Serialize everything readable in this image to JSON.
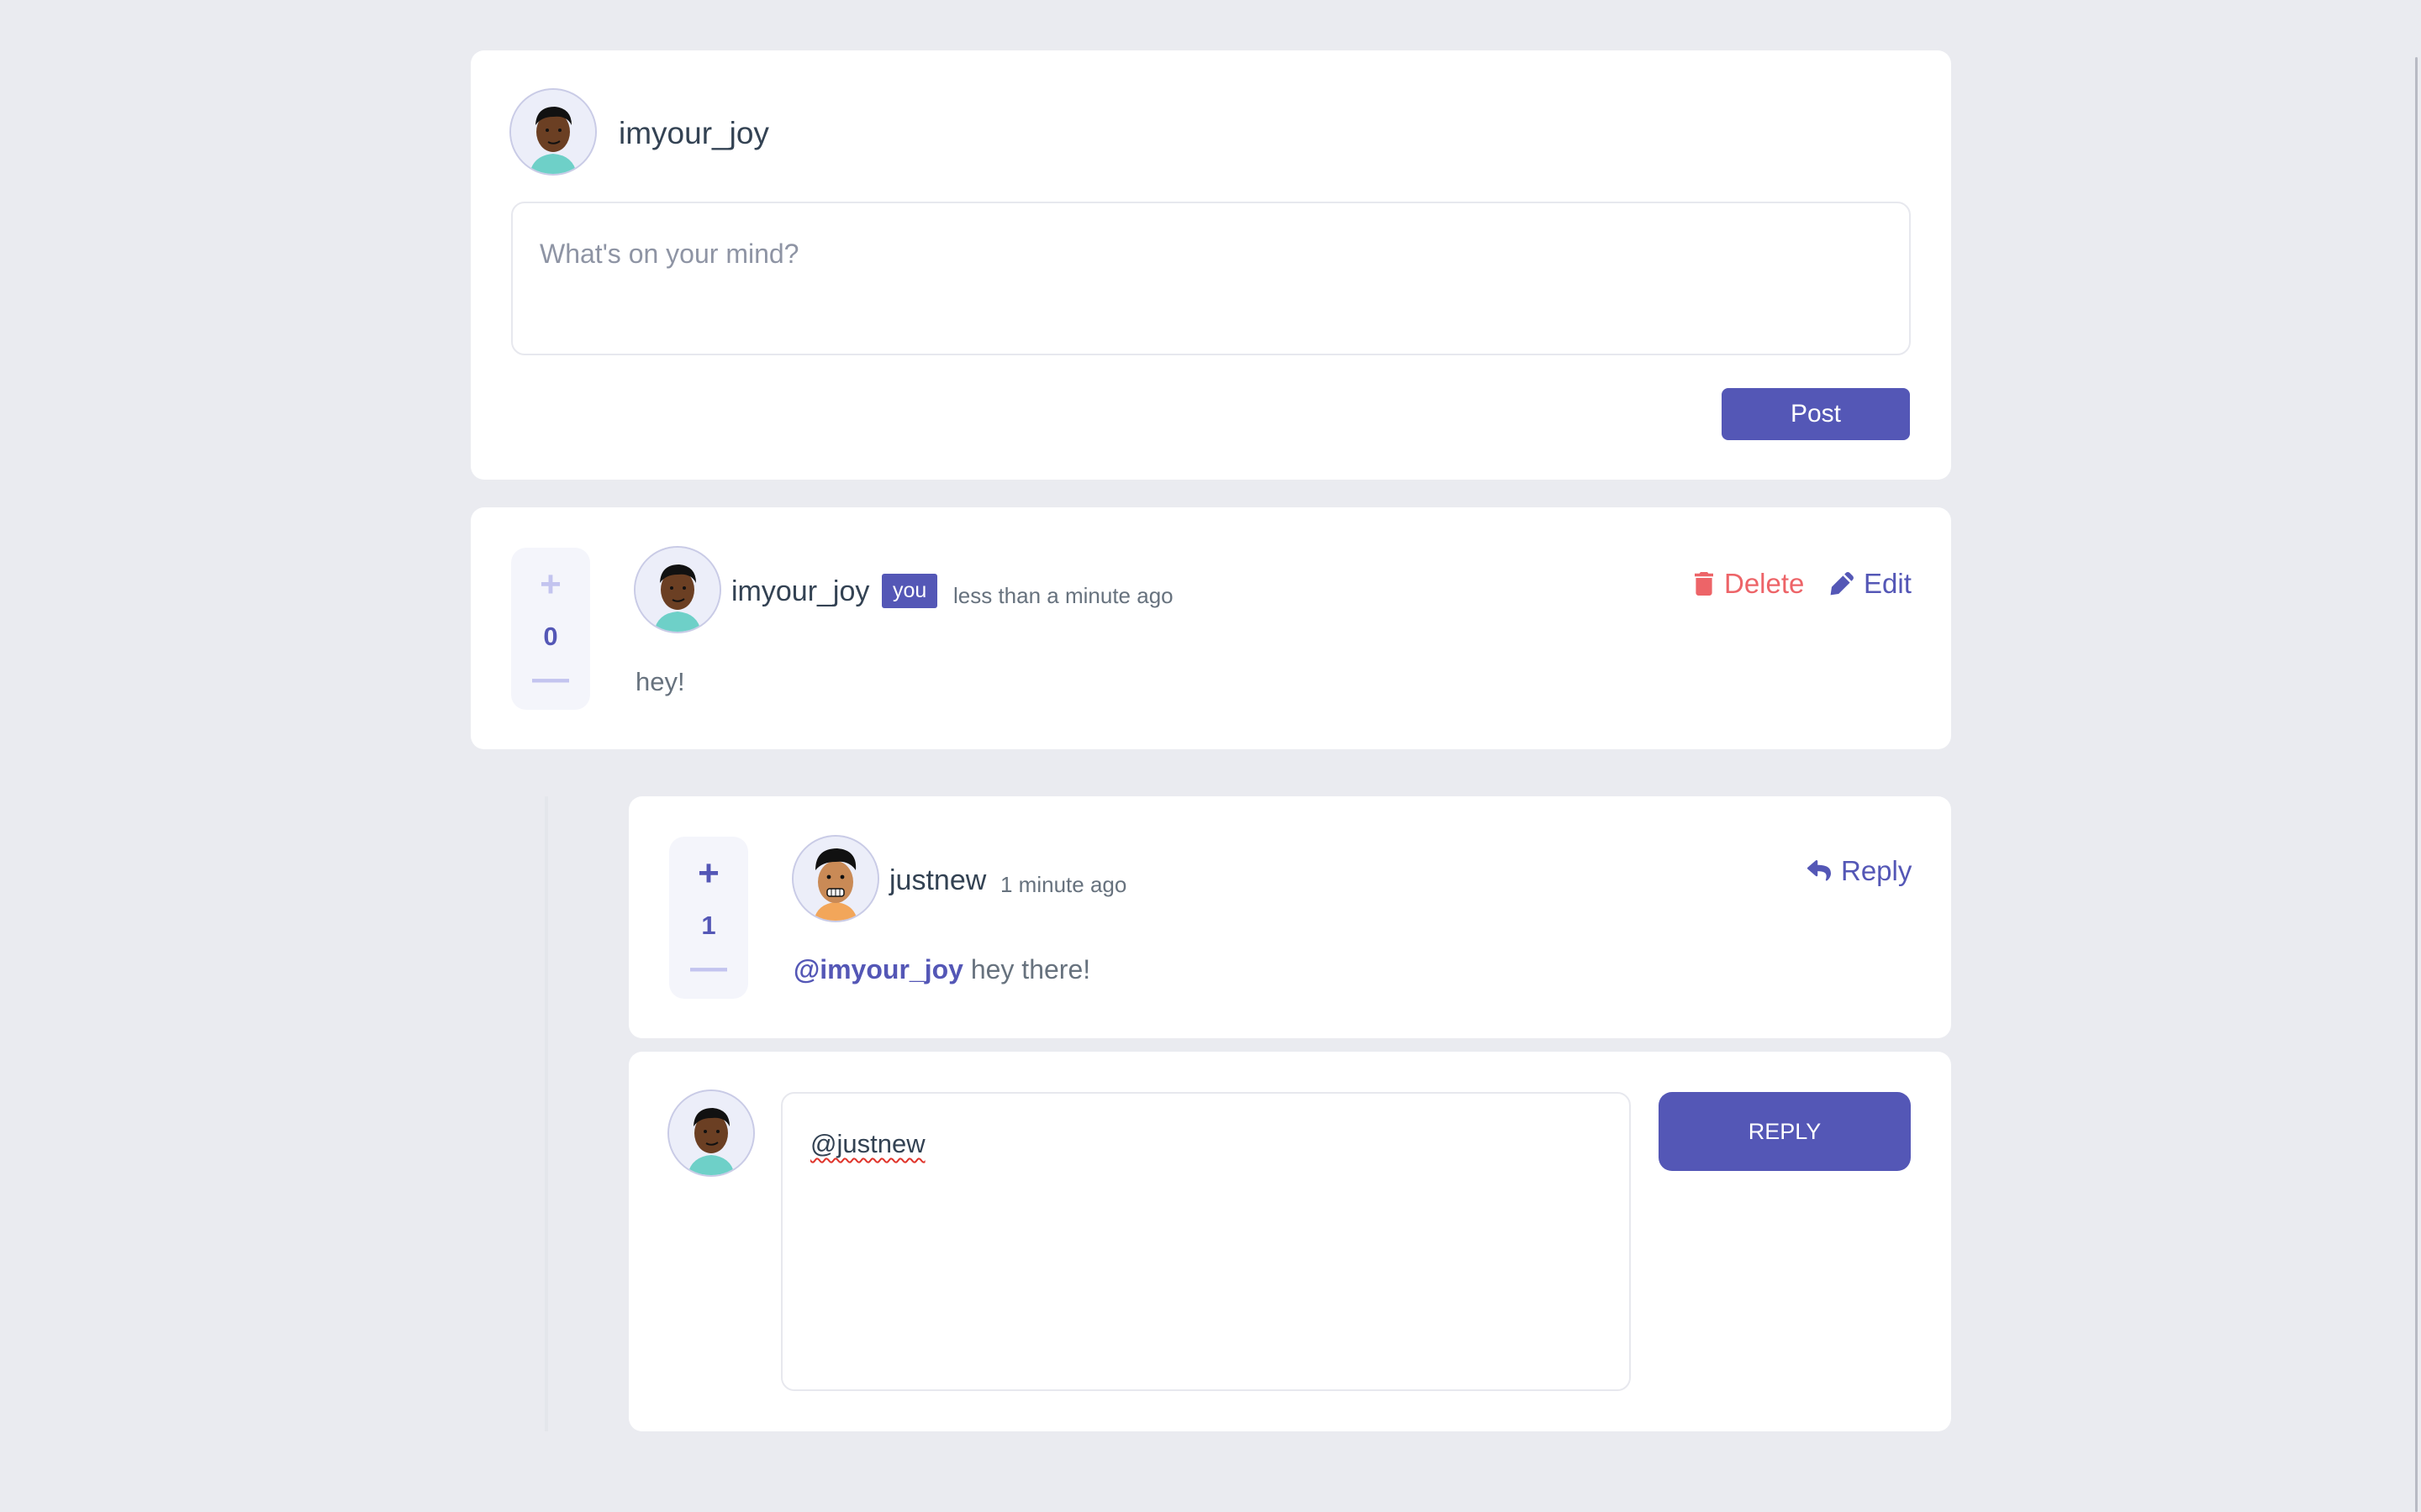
{
  "compose": {
    "username": "imyour_joy",
    "placeholder": "What's on your mind?",
    "post_label": "Post"
  },
  "comment": {
    "score": "0",
    "plus_symbol": "+",
    "minus_symbol": "—",
    "author": "imyour_joy",
    "you_badge": "you",
    "timestamp": "less than a minute ago",
    "body": "hey!",
    "delete_label": "Delete",
    "edit_label": "Edit"
  },
  "reply": {
    "score": "1",
    "plus_symbol": "+",
    "minus_symbol": "—",
    "author": "justnew",
    "timestamp": "1 minute ago",
    "mention": "@imyour_joy",
    "body": "hey there!",
    "reply_label": "Reply"
  },
  "reply_form": {
    "value": "@justnew",
    "submit_label": "REPLY"
  },
  "colors": {
    "accent": "#5457b6",
    "danger": "#ed6468",
    "background": "#eaebf0",
    "vote_bg": "#f4f5fb"
  },
  "icons": {
    "delete": "trash-icon",
    "edit": "pencil-icon",
    "reply": "reply-arrow-icon"
  }
}
